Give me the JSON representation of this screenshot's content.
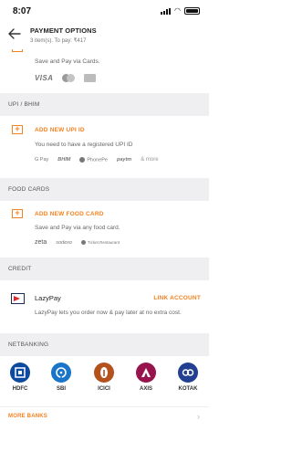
{
  "status_bar": {
    "time": "8:07"
  },
  "header": {
    "title": "PAYMENT OPTIONS",
    "subtitle": "3 item(s). To pay: ₹417"
  },
  "card": {
    "text": "Save and Pay via Cards.",
    "logos": [
      "VISA",
      "mastercard",
      "amex"
    ]
  },
  "upi": {
    "section_title": "UPI / BHIM",
    "add_label": "ADD NEW UPI ID",
    "sub_text": "You need to have a registered UPI ID",
    "apps": [
      "G Pay",
      "BHIM",
      "PhonePe",
      "paytm"
    ],
    "more": "& more"
  },
  "food_cards": {
    "section_title": "FOOD CARDS",
    "add_label": "ADD NEW FOOD CARD",
    "sub_text": "Save and Pay via any food card.",
    "brands": [
      "zeta",
      "sodexo",
      "Ticket Restaurant"
    ]
  },
  "credit": {
    "section_title": "CREDIT",
    "provider_name": "LazyPay",
    "action_label": "LINK ACCOUNT",
    "description": "LazyPay lets you order now & pay later at no extra cost."
  },
  "netbanking": {
    "section_title": "NETBANKING",
    "banks": [
      {
        "label": "HDFC",
        "color": "#0b4a9e"
      },
      {
        "label": "SBI",
        "color": "#1a74c8"
      },
      {
        "label": "ICICI",
        "color": "#b4521e"
      },
      {
        "label": "AXIS",
        "color": "#97144d"
      },
      {
        "label": "KOTAK",
        "color": "#233f8f"
      }
    ],
    "more_label": "MORE BANKS"
  },
  "colors": {
    "accent": "#f48220",
    "section_bg": "#efeff2"
  }
}
